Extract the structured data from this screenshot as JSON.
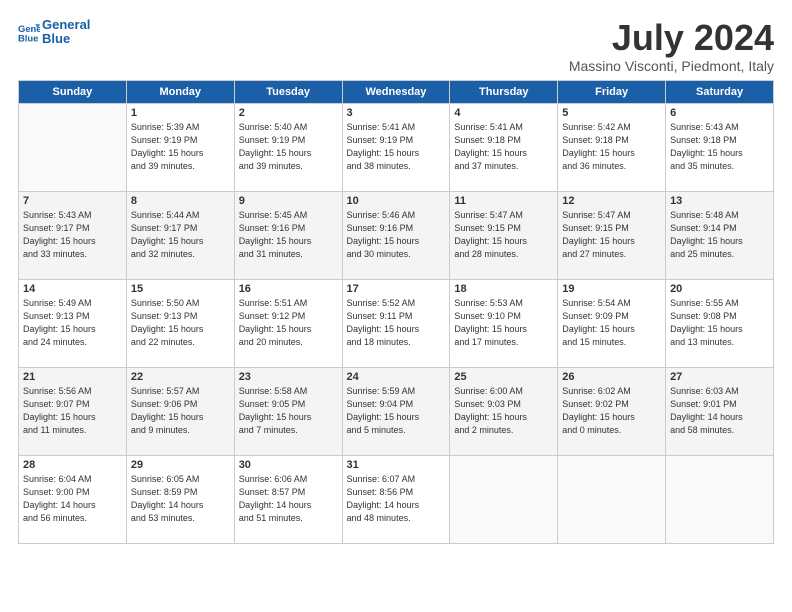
{
  "header": {
    "logo_line1": "General",
    "logo_line2": "Blue",
    "month": "July 2024",
    "location": "Massino Visconti, Piedmont, Italy"
  },
  "weekdays": [
    "Sunday",
    "Monday",
    "Tuesday",
    "Wednesday",
    "Thursday",
    "Friday",
    "Saturday"
  ],
  "weeks": [
    {
      "row_class": "week-row-1",
      "days": [
        {
          "num": "",
          "info": "",
          "empty": true
        },
        {
          "num": "1",
          "info": "Sunrise: 5:39 AM\nSunset: 9:19 PM\nDaylight: 15 hours\nand 39 minutes."
        },
        {
          "num": "2",
          "info": "Sunrise: 5:40 AM\nSunset: 9:19 PM\nDaylight: 15 hours\nand 39 minutes."
        },
        {
          "num": "3",
          "info": "Sunrise: 5:41 AM\nSunset: 9:19 PM\nDaylight: 15 hours\nand 38 minutes."
        },
        {
          "num": "4",
          "info": "Sunrise: 5:41 AM\nSunset: 9:18 PM\nDaylight: 15 hours\nand 37 minutes."
        },
        {
          "num": "5",
          "info": "Sunrise: 5:42 AM\nSunset: 9:18 PM\nDaylight: 15 hours\nand 36 minutes."
        },
        {
          "num": "6",
          "info": "Sunrise: 5:43 AM\nSunset: 9:18 PM\nDaylight: 15 hours\nand 35 minutes."
        }
      ]
    },
    {
      "row_class": "week-row-2",
      "days": [
        {
          "num": "7",
          "info": "Sunrise: 5:43 AM\nSunset: 9:17 PM\nDaylight: 15 hours\nand 33 minutes."
        },
        {
          "num": "8",
          "info": "Sunrise: 5:44 AM\nSunset: 9:17 PM\nDaylight: 15 hours\nand 32 minutes."
        },
        {
          "num": "9",
          "info": "Sunrise: 5:45 AM\nSunset: 9:16 PM\nDaylight: 15 hours\nand 31 minutes."
        },
        {
          "num": "10",
          "info": "Sunrise: 5:46 AM\nSunset: 9:16 PM\nDaylight: 15 hours\nand 30 minutes."
        },
        {
          "num": "11",
          "info": "Sunrise: 5:47 AM\nSunset: 9:15 PM\nDaylight: 15 hours\nand 28 minutes."
        },
        {
          "num": "12",
          "info": "Sunrise: 5:47 AM\nSunset: 9:15 PM\nDaylight: 15 hours\nand 27 minutes."
        },
        {
          "num": "13",
          "info": "Sunrise: 5:48 AM\nSunset: 9:14 PM\nDaylight: 15 hours\nand 25 minutes."
        }
      ]
    },
    {
      "row_class": "week-row-1",
      "days": [
        {
          "num": "14",
          "info": "Sunrise: 5:49 AM\nSunset: 9:13 PM\nDaylight: 15 hours\nand 24 minutes."
        },
        {
          "num": "15",
          "info": "Sunrise: 5:50 AM\nSunset: 9:13 PM\nDaylight: 15 hours\nand 22 minutes."
        },
        {
          "num": "16",
          "info": "Sunrise: 5:51 AM\nSunset: 9:12 PM\nDaylight: 15 hours\nand 20 minutes."
        },
        {
          "num": "17",
          "info": "Sunrise: 5:52 AM\nSunset: 9:11 PM\nDaylight: 15 hours\nand 18 minutes."
        },
        {
          "num": "18",
          "info": "Sunrise: 5:53 AM\nSunset: 9:10 PM\nDaylight: 15 hours\nand 17 minutes."
        },
        {
          "num": "19",
          "info": "Sunrise: 5:54 AM\nSunset: 9:09 PM\nDaylight: 15 hours\nand 15 minutes."
        },
        {
          "num": "20",
          "info": "Sunrise: 5:55 AM\nSunset: 9:08 PM\nDaylight: 15 hours\nand 13 minutes."
        }
      ]
    },
    {
      "row_class": "week-row-2",
      "days": [
        {
          "num": "21",
          "info": "Sunrise: 5:56 AM\nSunset: 9:07 PM\nDaylight: 15 hours\nand 11 minutes."
        },
        {
          "num": "22",
          "info": "Sunrise: 5:57 AM\nSunset: 9:06 PM\nDaylight: 15 hours\nand 9 minutes."
        },
        {
          "num": "23",
          "info": "Sunrise: 5:58 AM\nSunset: 9:05 PM\nDaylight: 15 hours\nand 7 minutes."
        },
        {
          "num": "24",
          "info": "Sunrise: 5:59 AM\nSunset: 9:04 PM\nDaylight: 15 hours\nand 5 minutes."
        },
        {
          "num": "25",
          "info": "Sunrise: 6:00 AM\nSunset: 9:03 PM\nDaylight: 15 hours\nand 2 minutes."
        },
        {
          "num": "26",
          "info": "Sunrise: 6:02 AM\nSunset: 9:02 PM\nDaylight: 15 hours\nand 0 minutes."
        },
        {
          "num": "27",
          "info": "Sunrise: 6:03 AM\nSunset: 9:01 PM\nDaylight: 14 hours\nand 58 minutes."
        }
      ]
    },
    {
      "row_class": "week-row-1",
      "days": [
        {
          "num": "28",
          "info": "Sunrise: 6:04 AM\nSunset: 9:00 PM\nDaylight: 14 hours\nand 56 minutes."
        },
        {
          "num": "29",
          "info": "Sunrise: 6:05 AM\nSunset: 8:59 PM\nDaylight: 14 hours\nand 53 minutes."
        },
        {
          "num": "30",
          "info": "Sunrise: 6:06 AM\nSunset: 8:57 PM\nDaylight: 14 hours\nand 51 minutes."
        },
        {
          "num": "31",
          "info": "Sunrise: 6:07 AM\nSunset: 8:56 PM\nDaylight: 14 hours\nand 48 minutes."
        },
        {
          "num": "",
          "info": "",
          "empty": true
        },
        {
          "num": "",
          "info": "",
          "empty": true
        },
        {
          "num": "",
          "info": "",
          "empty": true
        }
      ]
    }
  ]
}
